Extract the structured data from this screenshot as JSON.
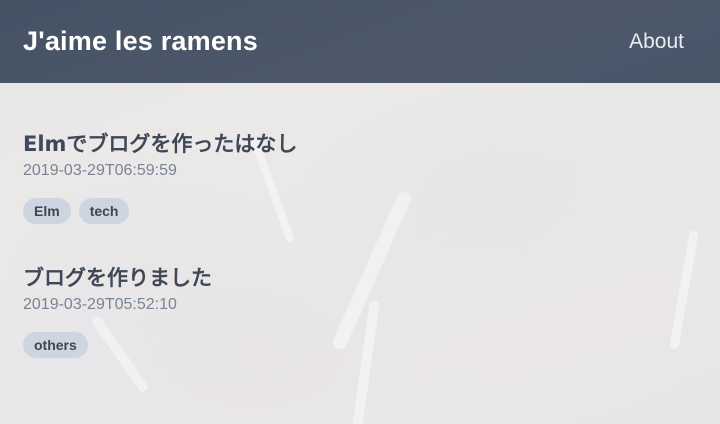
{
  "header": {
    "site_title": "J'aime les ramens",
    "nav": {
      "about_label": "About"
    }
  },
  "posts": [
    {
      "title": "Elmでブログを作ったはなし",
      "date": "2019-03-29T06:59:59",
      "tags": [
        "Elm",
        "tech"
      ]
    },
    {
      "title": "ブログを作りました",
      "date": "2019-03-29T05:52:10",
      "tags": [
        "others"
      ]
    }
  ],
  "colors": {
    "header_bg": "#364b63",
    "tag_bg": "#cdd6e0",
    "title_text": "#3f4856",
    "date_text": "#7a8594"
  }
}
